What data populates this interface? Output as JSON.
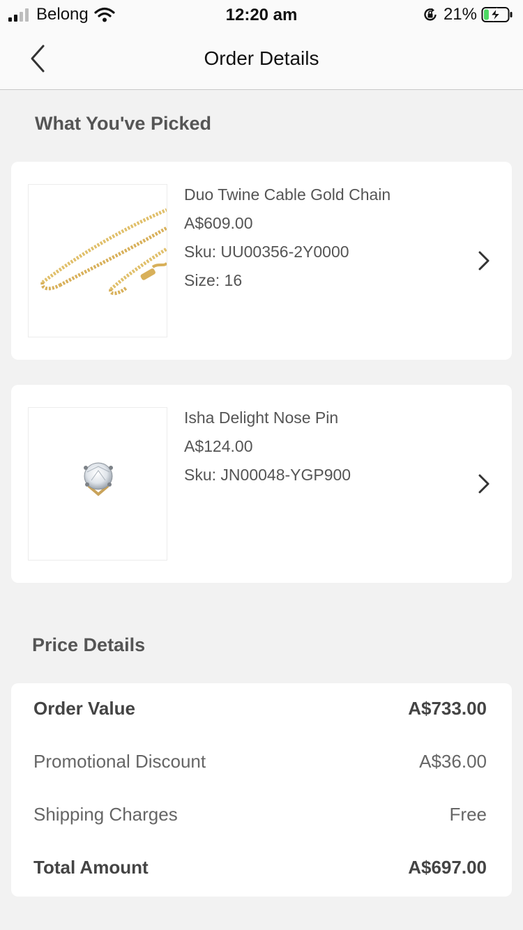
{
  "status_bar": {
    "carrier": "Belong",
    "time": "12:20 am",
    "battery_percent": "21%",
    "battery_level": 0.21,
    "battery_color": "#4cd964",
    "icons": [
      "signal-icon",
      "wifi-icon",
      "orientation-lock-icon",
      "battery-charging-icon"
    ]
  },
  "nav": {
    "title": "Order Details",
    "back_icon": "chevron-left-icon"
  },
  "picked_section": {
    "title": "What You've Picked"
  },
  "products": [
    {
      "name": "Duo Twine Cable Gold Chain",
      "price": "A$609.00",
      "sku": "Sku: UU00356-2Y0000",
      "size": "Size: 16",
      "image_icon": "gold-chain-image"
    },
    {
      "name": "Isha Delight Nose Pin",
      "price": "A$124.00",
      "sku": "Sku: JN00048-YGP900",
      "image_icon": "nose-pin-image"
    }
  ],
  "price_details": {
    "title": "Price Details",
    "rows": [
      {
        "label": "Order Value",
        "value": "A$733.00"
      },
      {
        "label": "Promotional Discount",
        "value": "A$36.00"
      },
      {
        "label": "Shipping Charges",
        "value": "Free"
      },
      {
        "label": "Total Amount",
        "value": "A$697.00"
      }
    ]
  },
  "colors": {
    "background": "#f2f2f2",
    "card": "#ffffff",
    "gold": "#d8b05a"
  }
}
